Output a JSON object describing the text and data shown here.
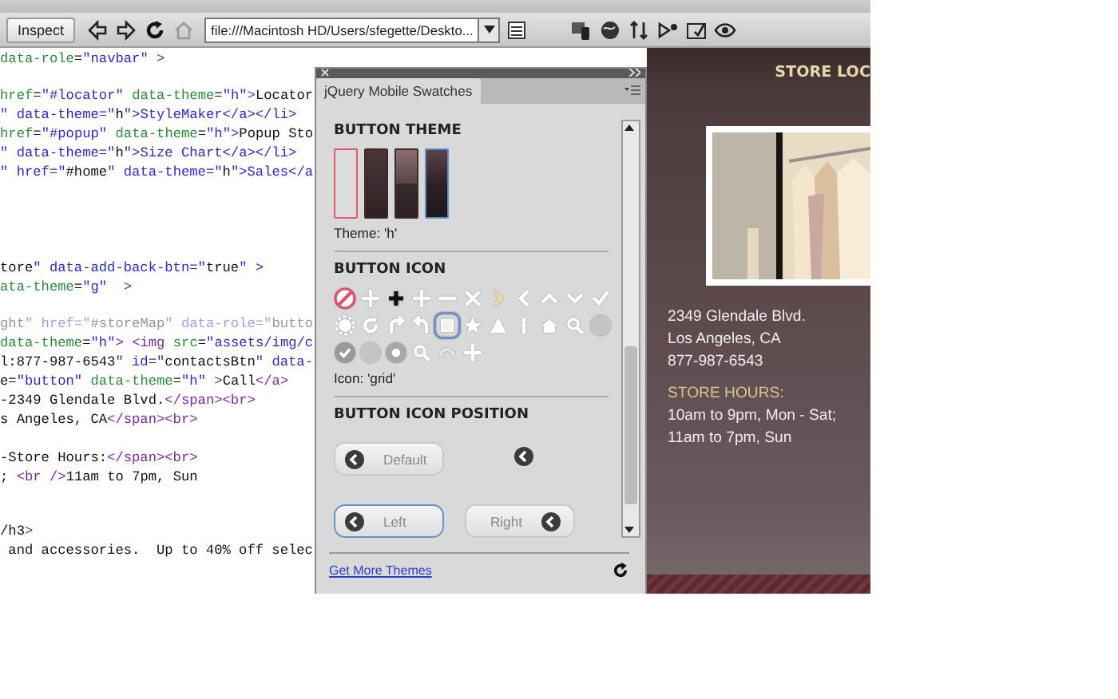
{
  "toolbar": {
    "inspect_button": "Inspect",
    "address": "file:///Macintosh HD/Users/sfegette/Deskto..."
  },
  "code": {
    "blocks": [
      [
        {
          "text": "data-role=\"navbar\" >"
        }
      ],
      [
        {
          "text": "href=\"#locator\" data-theme=\"h\">Locator"
        },
        {
          "text": "\" data-theme=\"h\">StyleMaker</a></li>"
        },
        {
          "text": "href=\"#popup\" data-theme=\"h\">Popup Sto"
        },
        {
          "text": "\" data-theme=\"h\">Size Chart</a></li>"
        },
        {
          "text": "\" href=\"#home\" data-theme=\"h\">Sales</a"
        }
      ],
      [
        {
          "text": "tore\" data-add-back-btn=\"true\" >"
        },
        {
          "text": "ata-theme=\"g\"  >"
        }
      ],
      [
        {
          "text": "ght\" href=\"#storeMap\" data-role=\"butto",
          "dim": true
        },
        {
          "text": "data-theme=\"h\"> <img src=\"assets/img/c"
        },
        {
          "text": "l:877-987-6543\" id=\"contactsBtn\" data-"
        },
        {
          "text": "e=\"button\" data-theme=\"h\" >Call</a>"
        },
        {
          "text": "-2349 Glendale Blvd.</span><br>"
        },
        {
          "text": "s Angeles, CA</span><br>"
        }
      ],
      [
        {
          "text": "-Store Hours:</span><br>"
        },
        {
          "text": "; <br />11am to 7pm, Sun"
        }
      ],
      [
        {
          "text": "/h3>"
        },
        {
          "text": " and accessories.  Up to 40% off selec"
        }
      ]
    ]
  },
  "swatches_panel": {
    "tab": "jQuery Mobile Swatches",
    "theme_section": {
      "heading": "BUTTON THEME",
      "swatches": [
        {
          "kind": "none",
          "selected": false
        },
        {
          "kind": "dark",
          "selected": false
        },
        {
          "kind": "split",
          "selected": false
        },
        {
          "kind": "deep",
          "selected": true
        }
      ],
      "caption": "Theme: 'h'"
    },
    "icon_section": {
      "heading": "BUTTON ICON",
      "icons": [
        {
          "kind": "delete",
          "selected": false
        },
        {
          "kind": "plus",
          "selected": false
        },
        {
          "kind": "plus-dark",
          "selected": false
        },
        {
          "kind": "plus",
          "selected": false
        },
        {
          "kind": "minus",
          "selected": false
        },
        {
          "kind": "close",
          "selected": false
        },
        {
          "kind": "arrow-right",
          "selected": false
        },
        {
          "kind": "arrow-left",
          "selected": false
        },
        {
          "kind": "arrow-up",
          "selected": false
        },
        {
          "kind": "arrow-down",
          "selected": false
        },
        {
          "kind": "check",
          "selected": false
        },
        {
          "kind": "gear",
          "selected": false
        },
        {
          "kind": "refresh",
          "selected": false
        },
        {
          "kind": "forward",
          "selected": false
        },
        {
          "kind": "back",
          "selected": false
        },
        {
          "kind": "grid",
          "selected": true
        },
        {
          "kind": "star",
          "selected": false
        },
        {
          "kind": "alert",
          "selected": false
        },
        {
          "kind": "info",
          "selected": false
        },
        {
          "kind": "home",
          "selected": false
        },
        {
          "kind": "search",
          "selected": false
        },
        {
          "kind": "circle",
          "selected": false
        },
        {
          "kind": "check-circle",
          "selected": false
        },
        {
          "kind": "circle",
          "selected": false
        },
        {
          "kind": "dot",
          "selected": false
        },
        {
          "kind": "search",
          "selected": false
        },
        {
          "kind": "faint",
          "selected": false
        },
        {
          "kind": "plus",
          "selected": false
        }
      ],
      "caption": "Icon: 'grid'"
    },
    "position_section": {
      "heading": "BUTTON ICON POSITION",
      "options": [
        {
          "kind": "left",
          "label": "Default",
          "selected": false
        },
        {
          "kind": "notext",
          "selected": false
        },
        {
          "kind": "left",
          "label": "Left",
          "selected": true
        },
        {
          "kind": "right",
          "label": "Right",
          "selected": false
        }
      ]
    },
    "footer_link": "Get More Themes"
  },
  "preview": {
    "header": "STORE LOC",
    "address": [
      "2349 Glendale Blvd.",
      "Los Angeles, CA",
      "877-987-6543"
    ],
    "hours_heading": "STORE HOURS:",
    "hours": [
      "10am to 9pm, Mon - Sat;",
      "11am to 7pm, Sun"
    ]
  }
}
